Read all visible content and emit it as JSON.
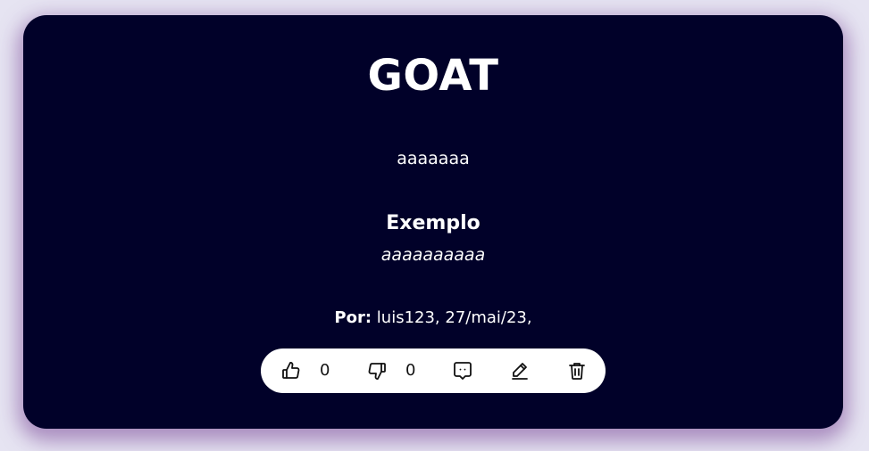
{
  "post": {
    "title": "GOAT",
    "description": "aaaaaaa",
    "example_heading": "Exemplo",
    "example_text": "aaaaaaaaaa",
    "author_label": "Por:",
    "author_info": "luis123, 27/mai/23,"
  },
  "actions": {
    "likes": "0",
    "dislikes": "0",
    "icons": [
      "thumbs-up-icon",
      "thumbs-down-icon",
      "comment-icon",
      "edit-icon",
      "trash-icon"
    ]
  },
  "colors": {
    "card_background": "#010129",
    "page_background": "#e6e4f2",
    "text": "#ffffff",
    "action_bar": "#ffffff"
  }
}
